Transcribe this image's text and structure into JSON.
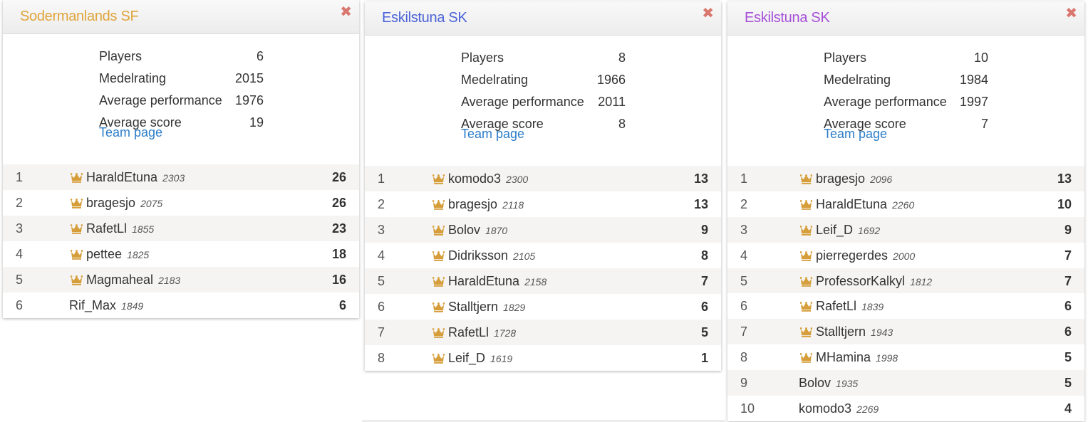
{
  "cards": [
    {
      "team_name": "Sodermanlands SF",
      "name_color": "#e0a43a",
      "close_glyph": "✖",
      "stats": [
        {
          "label": "Players",
          "value": "6"
        },
        {
          "label": "Medelrating",
          "value": "2015"
        },
        {
          "label": "Average performance",
          "value": "1976"
        },
        {
          "label": "Average score",
          "value": "19"
        }
      ],
      "team_link": "Team page",
      "players": [
        {
          "rank": "1",
          "name": "HaraldEtuna",
          "rating": "2303",
          "score": "26",
          "crown": true
        },
        {
          "rank": "2",
          "name": "bragesjo",
          "rating": "2075",
          "score": "26",
          "crown": true
        },
        {
          "rank": "3",
          "name": "RafetLl",
          "rating": "1855",
          "score": "23",
          "crown": true
        },
        {
          "rank": "4",
          "name": "pettee",
          "rating": "1825",
          "score": "18",
          "crown": true
        },
        {
          "rank": "5",
          "name": "Magmaheal",
          "rating": "2183",
          "score": "16",
          "crown": true
        },
        {
          "rank": "6",
          "name": "Rif_Max",
          "rating": "1849",
          "score": "6",
          "crown": false
        }
      ]
    },
    {
      "team_name": "Eskilstuna SK",
      "name_color": "#4b63d8",
      "close_glyph": "✖",
      "stats": [
        {
          "label": "Players",
          "value": "8"
        },
        {
          "label": "Medelrating",
          "value": "1966"
        },
        {
          "label": "Average performance",
          "value": "2011"
        },
        {
          "label": "Average score",
          "value": "8"
        }
      ],
      "team_link": "Team page",
      "players": [
        {
          "rank": "1",
          "name": "komodo3",
          "rating": "2300",
          "score": "13",
          "crown": true
        },
        {
          "rank": "2",
          "name": "bragesjo",
          "rating": "2118",
          "score": "13",
          "crown": true
        },
        {
          "rank": "3",
          "name": "Bolov",
          "rating": "1870",
          "score": "9",
          "crown": true
        },
        {
          "rank": "4",
          "name": "Didriksson",
          "rating": "2105",
          "score": "8",
          "crown": true
        },
        {
          "rank": "5",
          "name": "HaraldEtuna",
          "rating": "2158",
          "score": "7",
          "crown": true
        },
        {
          "rank": "6",
          "name": "Stalltjern",
          "rating": "1829",
          "score": "6",
          "crown": true
        },
        {
          "rank": "7",
          "name": "RafetLl",
          "rating": "1728",
          "score": "5",
          "crown": true
        },
        {
          "rank": "8",
          "name": "Leif_D",
          "rating": "1619",
          "score": "1",
          "crown": true
        }
      ]
    },
    {
      "team_name": "Eskilstuna SK",
      "name_color": "#a64fd8",
      "close_glyph": "✖",
      "stats": [
        {
          "label": "Players",
          "value": "10"
        },
        {
          "label": "Medelrating",
          "value": "1984"
        },
        {
          "label": "Average performance",
          "value": "1997"
        },
        {
          "label": "Average score",
          "value": "7"
        }
      ],
      "team_link": "Team page",
      "players": [
        {
          "rank": "1",
          "name": "bragesjo",
          "rating": "2096",
          "score": "13",
          "crown": true
        },
        {
          "rank": "2",
          "name": "HaraldEtuna",
          "rating": "2260",
          "score": "10",
          "crown": true
        },
        {
          "rank": "3",
          "name": "Leif_D",
          "rating": "1692",
          "score": "9",
          "crown": true
        },
        {
          "rank": "4",
          "name": "pierregerdes",
          "rating": "2000",
          "score": "7",
          "crown": true
        },
        {
          "rank": "5",
          "name": "ProfessorKalkyl",
          "rating": "1812",
          "score": "7",
          "crown": true
        },
        {
          "rank": "6",
          "name": "RafetLl",
          "rating": "1839",
          "score": "6",
          "crown": true
        },
        {
          "rank": "7",
          "name": "Stalltjern",
          "rating": "1943",
          "score": "6",
          "crown": true
        },
        {
          "rank": "8",
          "name": "MHamina",
          "rating": "1998",
          "score": "5",
          "crown": true
        },
        {
          "rank": "9",
          "name": "Bolov",
          "rating": "1935",
          "score": "5",
          "crown": false
        },
        {
          "rank": "10",
          "name": "komodo3",
          "rating": "2269",
          "score": "4",
          "crown": false
        }
      ]
    }
  ],
  "crown_color": "#d69e3a"
}
